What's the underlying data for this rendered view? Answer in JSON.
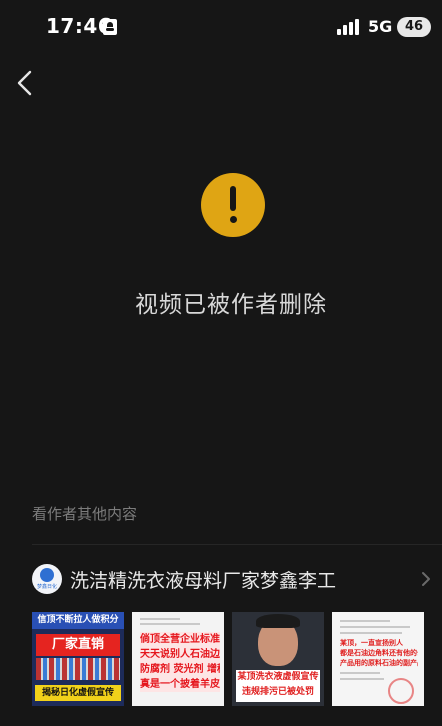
{
  "status_bar": {
    "time": "17:46",
    "network": "5G",
    "battery": "46"
  },
  "navigation": {
    "back_icon": "chevron-left-icon"
  },
  "notice": {
    "icon": "warning-icon",
    "icon_color": "#dfa514",
    "message": "视频已被作者删除"
  },
  "more_from_author": {
    "title": "看作者其他内容",
    "author_name": "洗洁精洗衣液母料厂家梦鑫李工",
    "avatar_text": "梦鑫日化",
    "thumbnails": [
      {
        "top_text": "信顶不断拉人做积分",
        "banner_text": "厂家直销",
        "bottom_text": "揭秘日化虚假宣传"
      },
      {
        "lines": [
          "倘顶全营企业标准",
          "天天说别人石油边角料",
          "防腐剂 荧光剂 增稠剂",
          "真是一个披着羊皮的狼"
        ]
      },
      {
        "caption_lines": [
          "某顶洗衣液虚假宣传",
          "违规排污已被处罚"
        ]
      },
      {
        "lines": [
          "某顶，一直宣扬别人",
          "都是石油边角料还有他的公司",
          "产品用的原料石油的副产品"
        ]
      }
    ]
  },
  "colors": {
    "background": "#161616",
    "text_primary": "#e6e6e6",
    "text_secondary": "#7c7c7c",
    "accent_red": "#e01e1e"
  }
}
